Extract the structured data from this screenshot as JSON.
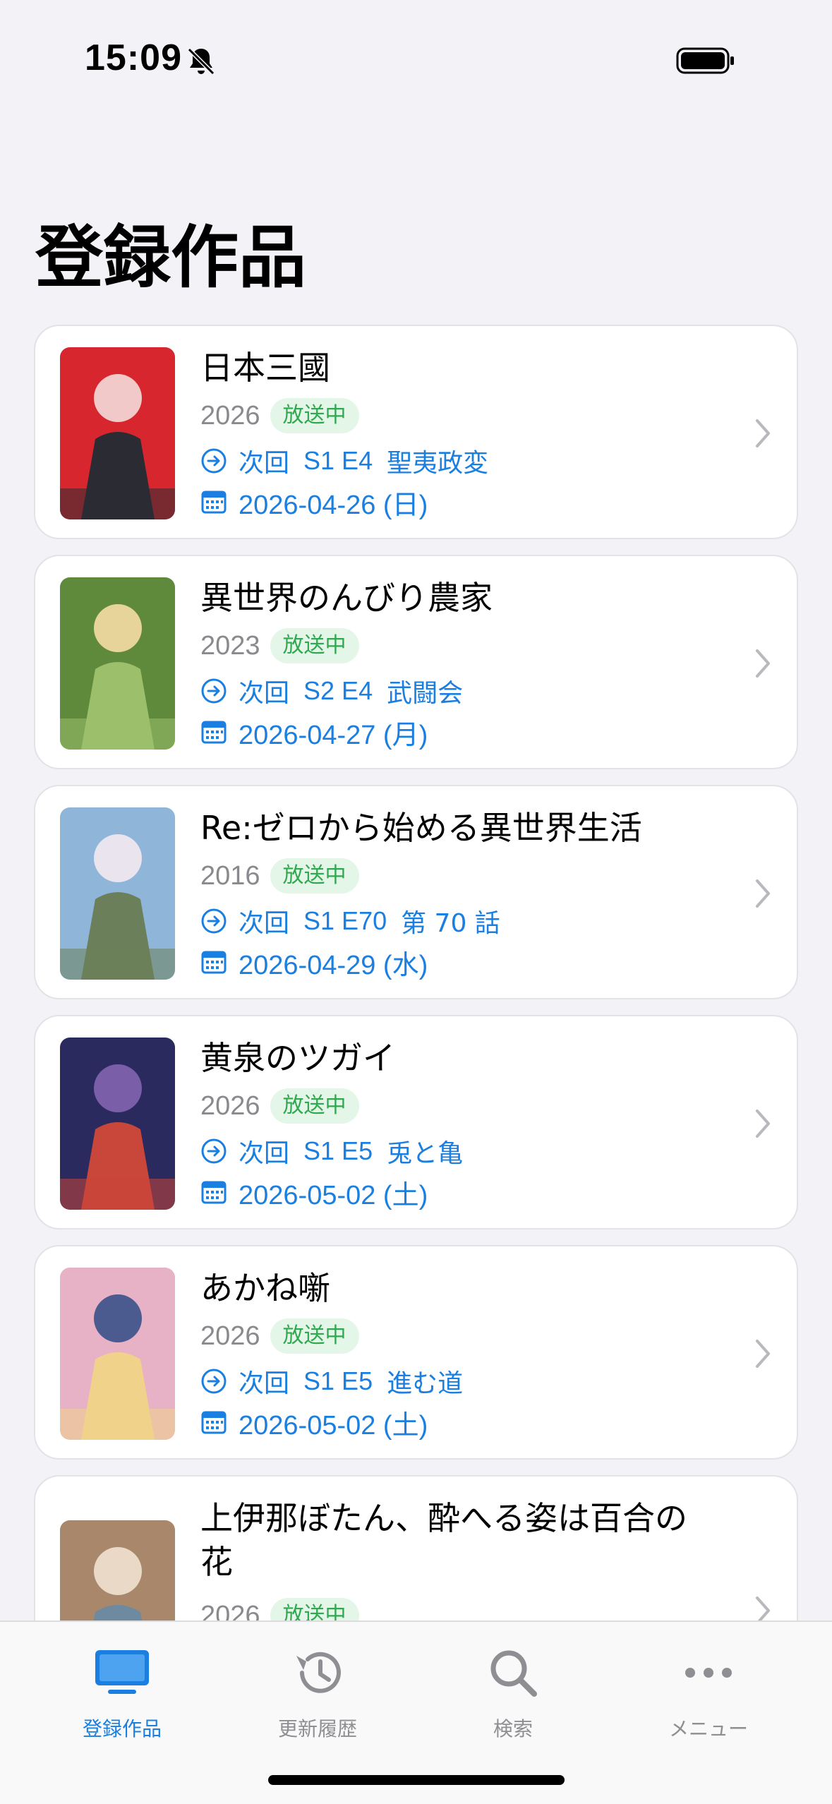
{
  "status_bar": {
    "time": "15:09"
  },
  "page_title": "登録作品",
  "items": [
    {
      "title": "日本三國",
      "year": "2026",
      "status": "放送中",
      "next_label": "次回",
      "episode": "S1 E4",
      "episode_title": "聖夷政変",
      "date": "2026-04-26 (日)",
      "poster_colors": [
        "#d8262e",
        "#f2c9c9",
        "#2b2b33"
      ]
    },
    {
      "title": "異世界のんびり農家",
      "year": "2023",
      "status": "放送中",
      "next_label": "次回",
      "episode": "S2 E4",
      "episode_title": "武闘会",
      "date": "2026-04-27 (月)",
      "poster_colors": [
        "#5f8a3c",
        "#e6d49a",
        "#9bbf6a"
      ]
    },
    {
      "title": "Re:ゼロから始める異世界生活",
      "year": "2016",
      "status": "放送中",
      "next_label": "次回",
      "episode": "S1 E70",
      "episode_title": "第 70 話",
      "date": "2026-04-29 (水)",
      "poster_colors": [
        "#8fb6d8",
        "#e9e4ee",
        "#6b7f5a"
      ]
    },
    {
      "title": "黄泉のツガイ",
      "year": "2026",
      "status": "放送中",
      "next_label": "次回",
      "episode": "S1 E5",
      "episode_title": "兎と亀",
      "date": "2026-05-02 (土)",
      "poster_colors": [
        "#2b2a5e",
        "#7a5ea8",
        "#c9463a"
      ]
    },
    {
      "title": "あかね噺",
      "year": "2026",
      "status": "放送中",
      "next_label": "次回",
      "episode": "S1 E5",
      "episode_title": "進む道",
      "date": "2026-05-02 (土)",
      "poster_colors": [
        "#e7b2c6",
        "#4b5a8f",
        "#f0d28a"
      ]
    },
    {
      "title": "上伊那ぼたん、酔へる姿は百合の花",
      "year": "2026",
      "status": "放送中",
      "poster_colors": [
        "#a8876a",
        "#e9d9c6",
        "#6d8aa0"
      ]
    }
  ],
  "tabs": [
    {
      "label": "登録作品",
      "icon": "tv-icon",
      "active": true
    },
    {
      "label": "更新履歴",
      "icon": "history-icon",
      "active": false
    },
    {
      "label": "検索",
      "icon": "search-icon",
      "active": false
    },
    {
      "label": "メニュー",
      "icon": "more-icon",
      "active": false
    }
  ],
  "colors": {
    "accent": "#1a7fe0",
    "badge_text": "#2fa84f",
    "badge_bg": "#e3f6e8",
    "background": "#f2f2f7"
  }
}
